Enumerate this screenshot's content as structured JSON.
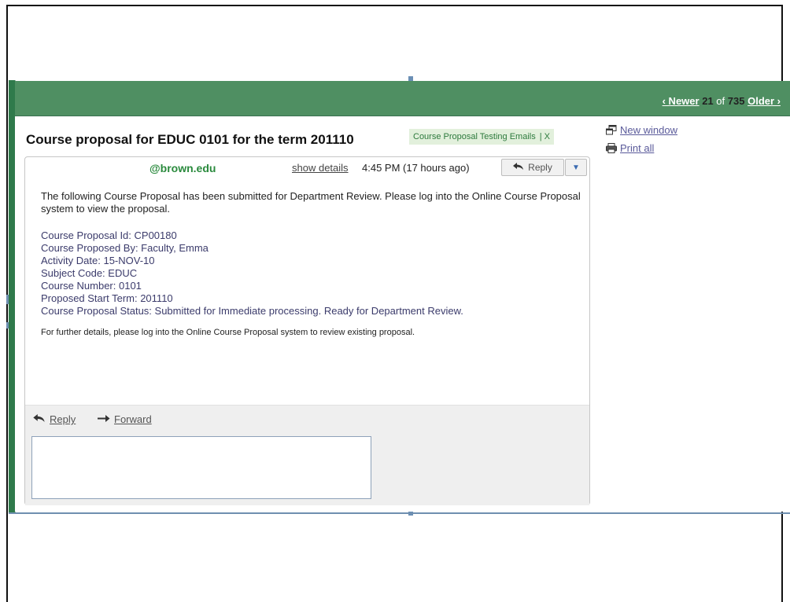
{
  "pager": {
    "newer": "‹ Newer",
    "count": "21",
    "of": "of",
    "total": "735",
    "older": "Older ›"
  },
  "subject": "Course proposal for EDUC 0101 for the term 201110",
  "label": {
    "text": "Course Proposal Testing Emails",
    "remove": "| X"
  },
  "side_actions": {
    "new_window": "New window",
    "print_all": "Print all"
  },
  "message": {
    "sender": "@brown.edu",
    "show_details": "show details",
    "time": "4:45 PM (17 hours ago)",
    "reply_button": "Reply",
    "intro": "The following Course Proposal has been submitted for Department Review.  Please log into the Online Course Proposal system to view the proposal.",
    "details": [
      "Course Proposal Id: CP00180",
      "Course Proposed By: Faculty, Emma",
      "Activity Date: 15-NOV-10",
      "Subject Code: EDUC",
      "Course Number: 0101",
      "Proposed Start Term: 201110",
      "Course Proposal Status: Submitted for Immediate processing. Ready for Department Review."
    ],
    "footer": "For further details, please log into the Online Course Proposal system to review existing proposal."
  },
  "reply_area": {
    "reply": "Reply",
    "forward": "Forward"
  },
  "colors": {
    "gmail_green": "#4f8f62",
    "sender_green": "#2a8a3d",
    "chip_bg": "#e2f0dc"
  }
}
